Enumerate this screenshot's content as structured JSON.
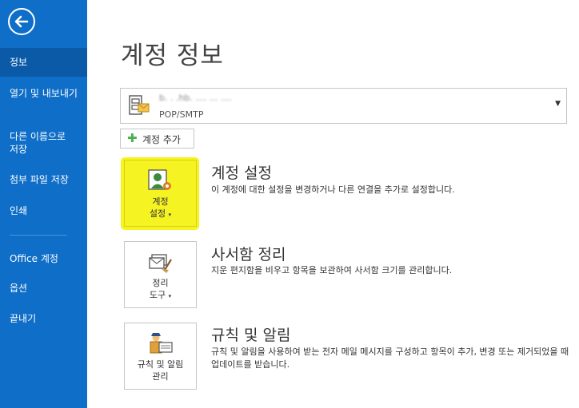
{
  "sidebar": {
    "items": [
      {
        "label": "정보",
        "selected": true
      },
      {
        "label": "열기 및 내보내기"
      },
      {
        "label": "다른 이름으로 저장"
      },
      {
        "label": "첨부 파일 저장"
      },
      {
        "label": "인쇄"
      },
      {
        "label": "Office 계정"
      },
      {
        "label": "옵션"
      },
      {
        "label": "끝내기"
      }
    ]
  },
  "page": {
    "title": "계정 정보"
  },
  "account": {
    "email": "b. . .hb. .... ... ....",
    "type": "POP/SMTP"
  },
  "add_account": {
    "label": "계정 추가"
  },
  "sections": [
    {
      "tile_line1": "계정",
      "tile_line2": "설정",
      "title": "계정 설정",
      "description": "이 계정에 대한 설정을 변경하거나 다른 연결을 추가로 설정합니다."
    },
    {
      "tile_line1": "정리",
      "tile_line2": "도구",
      "title": "사서함 정리",
      "description": "지운 편지함을 비우고 항목을 보관하여 사서함 크기를 관리합니다."
    },
    {
      "tile_line1": "규칙 및 알림",
      "tile_line2": "관리",
      "title": "규칙 및 알림",
      "description": "규칙 및 알림을 사용하여 받는 전자 메일 메시지를 구성하고 항목이 추가, 변경 또는 제거되었을 때 업데이트를 받습니다."
    }
  ],
  "colors": {
    "sidebar": "#0f6ec8",
    "selected": "#0a5aa8",
    "highlight": "#f6f323"
  }
}
